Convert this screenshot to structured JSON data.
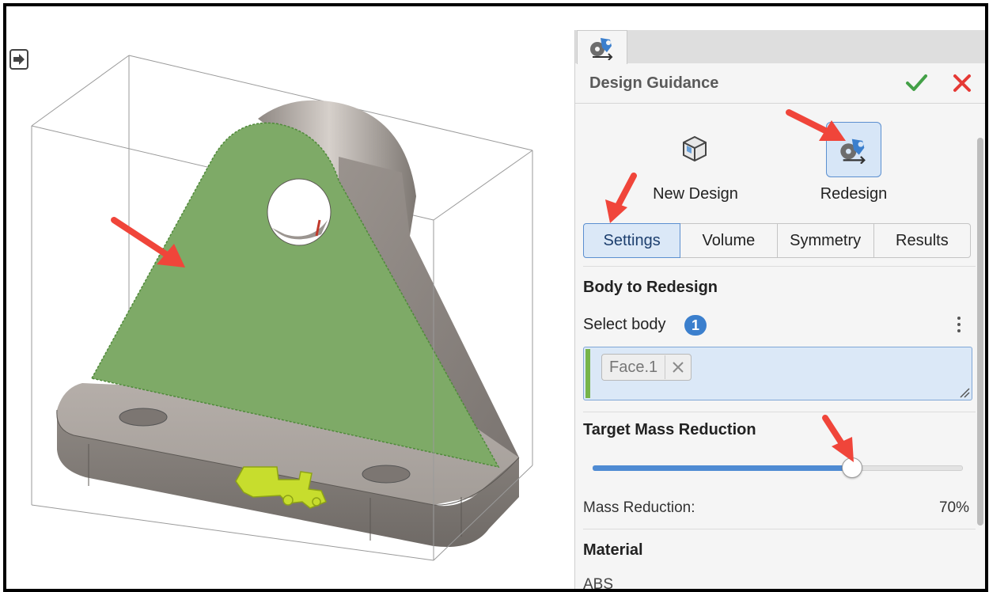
{
  "panel": {
    "title": "Design Guidance",
    "confirm_icon": "check-icon",
    "cancel_icon": "close-icon",
    "modes": [
      {
        "label": "New Design",
        "icon": "cube-icon",
        "selected": false
      },
      {
        "label": "Redesign",
        "icon": "redesign-icon",
        "selected": true
      }
    ],
    "tabs": [
      {
        "label": "Settings",
        "active": true
      },
      {
        "label": "Volume",
        "active": false
      },
      {
        "label": "Symmetry",
        "active": false
      },
      {
        "label": "Results",
        "active": false
      }
    ]
  },
  "body_section": {
    "title": "Body to Redesign",
    "select_label": "Select body",
    "count": "1",
    "chip": "Face.1"
  },
  "mass_section": {
    "title": "Target Mass Reduction",
    "slider_fraction": 0.7,
    "label": "Mass Reduction:",
    "value": "70%"
  },
  "material_section": {
    "title": "Material",
    "value": "ABS"
  },
  "colors": {
    "accent": "#4f8bd3",
    "selection_face": "#7eaa67",
    "confirm": "#43a047",
    "cancel": "#e53935",
    "callout_arrow": "#f0453a",
    "part_body": "#a29b96"
  }
}
